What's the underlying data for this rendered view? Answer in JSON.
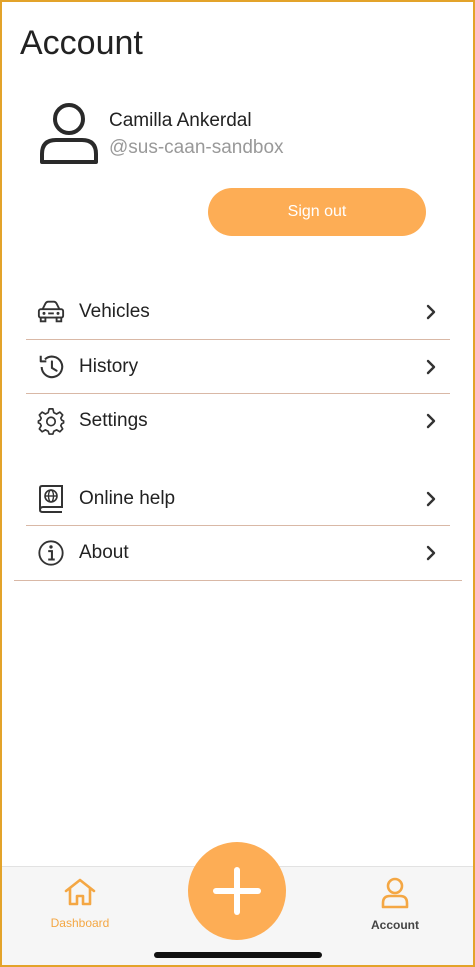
{
  "header": {
    "title": "Account"
  },
  "profile": {
    "name": "Camilla Ankerdal",
    "handle": "@sus-caan-sandbox"
  },
  "actions": {
    "sign_out": "Sign out"
  },
  "menu": {
    "vehicles": "Vehicles",
    "history": "History",
    "settings": "Settings",
    "online_help": "Online help",
    "about": "About"
  },
  "tabs": {
    "dashboard": "Dashboard",
    "account": "Account"
  },
  "colors": {
    "accent": "#fdad55",
    "border": "#e3a32a",
    "divider": "#d9b8a6"
  }
}
